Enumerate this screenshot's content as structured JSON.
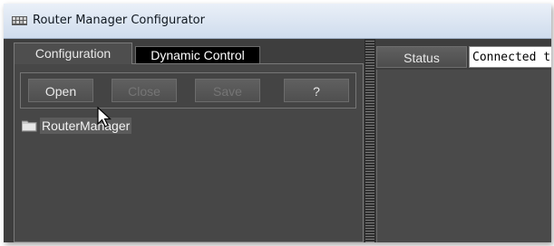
{
  "window": {
    "title": "Router Manager Configurator",
    "icon": "router-manager-app-icon"
  },
  "tabs": [
    {
      "label": "Configuration",
      "selected": true
    },
    {
      "label": "Dynamic Control",
      "selected": false
    }
  ],
  "toolbar": {
    "open_label": "Open",
    "close_label": "Close",
    "save_label": "Save",
    "help_label": "?"
  },
  "tree": {
    "items": [
      {
        "label": "RouterManager",
        "icon": "folder-icon"
      }
    ]
  },
  "status": {
    "label": "Status",
    "value": "Connected t"
  },
  "colors": {
    "background": "#3e3e3e",
    "panel": "#474747",
    "tab_inactive": "#000000",
    "titlebar": "#d9e4f1"
  }
}
